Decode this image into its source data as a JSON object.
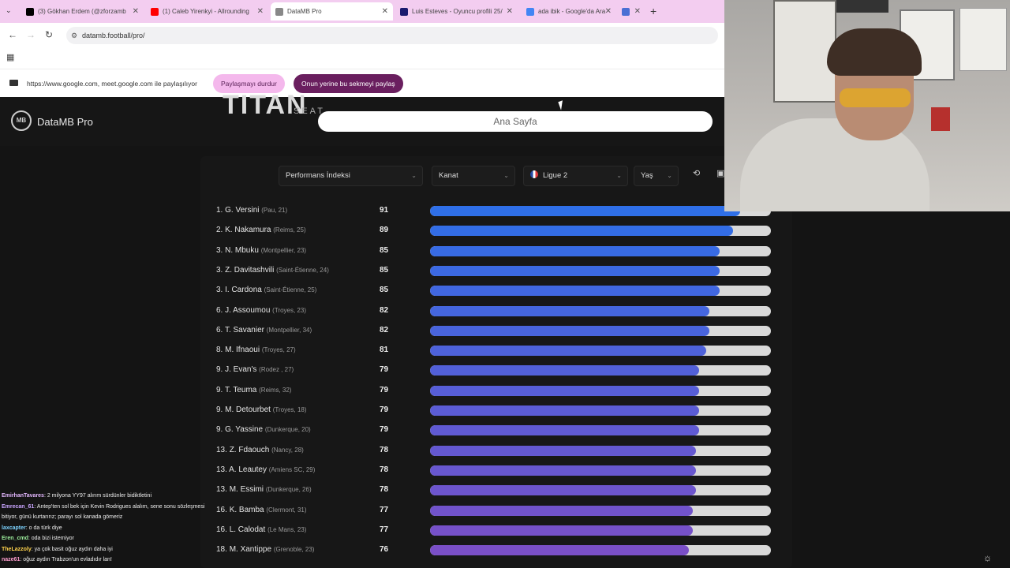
{
  "browser": {
    "tabs": [
      {
        "label": "(3) Gökhan Erdem (@zforzamb",
        "favicon_color": "#000000",
        "active": false
      },
      {
        "label": "(1) Caleb Yirenkyi - Allrounding",
        "favicon_color": "#ff0000",
        "active": false
      },
      {
        "label": "DataMB Pro",
        "favicon_color": "#888888",
        "active": true
      },
      {
        "label": "Luis Esteves - Oyuncu profili 25/",
        "favicon_color": "#1a1a6e",
        "active": false
      },
      {
        "label": "ada ibik - Google'da Ara",
        "favicon_color": "#4285f4",
        "active": false
      },
      {
        "label": "",
        "favicon_color": "#4a6fd4",
        "active": false
      }
    ],
    "url": "datamb.football/pro/",
    "share_notice": "https://www.google.com, meet.google.com ile paylaşılıyor",
    "stop_sharing_label": "Paylaşmayı durdur",
    "share_this_tab_label": "Onun yerine bu sekmeyi paylaş"
  },
  "site": {
    "title": "DataMB Pro",
    "logo_text": "MB",
    "sponsor_text": "TITAN",
    "sponsor_sub": "SEAT",
    "search_value": "Ana Sayfa"
  },
  "filters": {
    "metric": "Performans İndeksi",
    "position": "Kanat",
    "league": "Ligue 2",
    "age": "Yaş"
  },
  "chart_data": {
    "type": "bar",
    "orientation": "horizontal",
    "xlim": [
      0,
      100
    ],
    "rows": [
      {
        "rank": "1.",
        "name": "G. Versini",
        "meta": "(Pau, 21)",
        "value": 91
      },
      {
        "rank": "2.",
        "name": "K. Nakamura",
        "meta": "(Reims, 25)",
        "value": 89
      },
      {
        "rank": "3.",
        "name": "N. Mbuku",
        "meta": "(Montpellier, 23)",
        "value": 85
      },
      {
        "rank": "3.",
        "name": "Z. Davitashvili",
        "meta": "(Saint-Étienne, 24)",
        "value": 85
      },
      {
        "rank": "3.",
        "name": "I. Cardona",
        "meta": "(Saint-Étienne, 25)",
        "value": 85
      },
      {
        "rank": "6.",
        "name": "J. Assoumou",
        "meta": "(Troyes, 23)",
        "value": 82
      },
      {
        "rank": "6.",
        "name": "T. Savanier",
        "meta": "(Montpellier, 34)",
        "value": 82
      },
      {
        "rank": "8.",
        "name": "M. Ifnaoui",
        "meta": "(Troyes, 27)",
        "value": 81
      },
      {
        "rank": "9.",
        "name": "J. Evan's",
        "meta": "(Rodez , 27)",
        "value": 79
      },
      {
        "rank": "9.",
        "name": "T. Teuma",
        "meta": "(Reims, 32)",
        "value": 79
      },
      {
        "rank": "9.",
        "name": "M. Detourbet",
        "meta": "(Troyes, 18)",
        "value": 79
      },
      {
        "rank": "9.",
        "name": "G. Yassine",
        "meta": "(Dunkerque, 20)",
        "value": 79
      },
      {
        "rank": "13.",
        "name": "Z. Fdaouch",
        "meta": "(Nancy, 28)",
        "value": 78
      },
      {
        "rank": "13.",
        "name": "A. Leautey",
        "meta": "(Amiens SC, 29)",
        "value": 78
      },
      {
        "rank": "13.",
        "name": "M. Essimi",
        "meta": "(Dunkerque, 26)",
        "value": 78
      },
      {
        "rank": "16.",
        "name": "K. Bamba",
        "meta": "(Clermont, 31)",
        "value": 77
      },
      {
        "rank": "16.",
        "name": "L. Calodat",
        "meta": "(Le Mans, 23)",
        "value": 77
      },
      {
        "rank": "18.",
        "name": "M. Xantippe",
        "meta": "(Grenoble, 23)",
        "value": 76
      }
    ],
    "colors": {
      "high": "#2f6fe8",
      "low": "#7a4fc7",
      "track": "#d9d9d9"
    }
  },
  "chat": [
    {
      "user": "EmirhanTavares",
      "color": "#e4b8ff",
      "text": ": 2 milyona YY97 alırım sürdünler bidiktletini"
    },
    {
      "user": "Emrecan_61",
      "color": "#c9a5ff",
      "text": ": Antep'ten sol bek için Kevin Rodrigues alalım, sene sonu sözleşmesi bitiyor, günü kurtarırız; parayı sol kanada gömeriz"
    },
    {
      "user": "laxcapter",
      "color": "#7dd3ff",
      "text": ": o da türk diye"
    },
    {
      "user": "Eren_cmd",
      "color": "#9ef09e",
      "text": ": oda bizi istemiyor"
    },
    {
      "user": "TheLazzoly",
      "color": "#ffd34d",
      "text": ": ya çok basit oğuz aydın daha iyi"
    },
    {
      "user": "naze61",
      "color": "#ff9ecf",
      "text": ": oğuz aydın Trabzon'un evladıdır lan!"
    }
  ]
}
